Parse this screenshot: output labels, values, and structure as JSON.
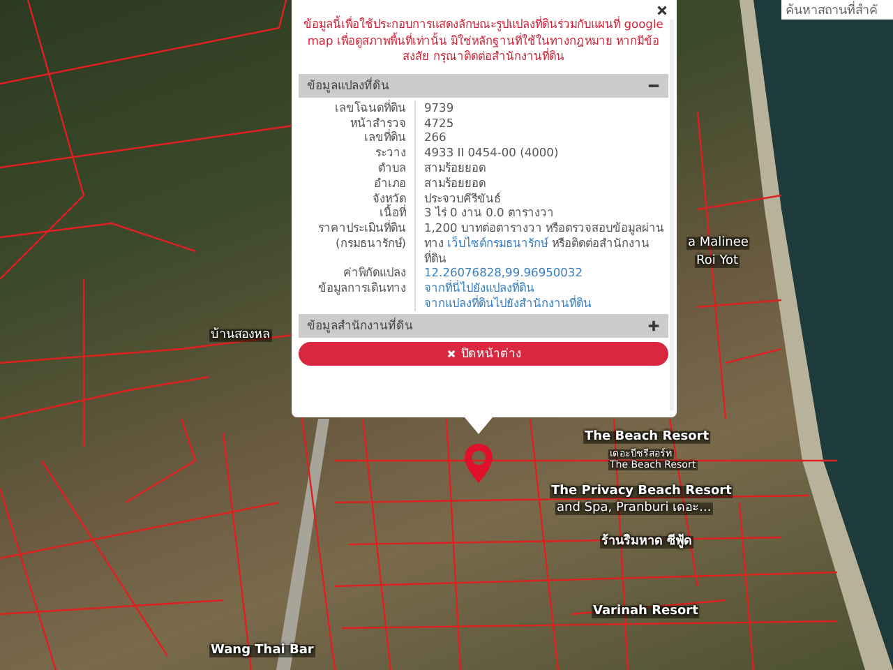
{
  "search": {
    "placeholder": "ค้นหาสถานที่สำคั"
  },
  "map_labels": [
    {
      "text": "a Malinee",
      "kind": "place"
    },
    {
      "text": "Roi Yot",
      "kind": "place"
    },
    {
      "text": "บ้านสองหล",
      "kind": "place"
    },
    {
      "text": "The Beach Resort",
      "kind": "hotel"
    },
    {
      "text": "เดอะบีชรีสอร์ท",
      "kind": "small"
    },
    {
      "text": "The Beach Resort",
      "kind": "small"
    },
    {
      "text": "The Privacy Beach Resort",
      "kind": "hotel"
    },
    {
      "text": "and Spa, Pranburi เดอะ...",
      "kind": "place"
    },
    {
      "text": "ร้านริมหาด ซีฟู้ด",
      "kind": "food"
    },
    {
      "text": "Varinah Resort",
      "kind": "hotel"
    },
    {
      "text": "Wang Thai Bar",
      "kind": "food"
    }
  ],
  "popup": {
    "notice": "ข้อมูลนี้เพื่อใช้ประกอบการแสดงลักษณะรูปแปลงที่ดินร่วมกับแผนที่ google map เพื่อดูสภาพพื้นที่เท่านั้น มิใช่หลักฐานที่ใช้ในทางกฎหมาย หากมีข้อสงสัย กรุณาติดต่อสำนักงานที่ดิน",
    "sections": [
      {
        "title": "ข้อมูลแปลงที่ดิน",
        "expanded": true,
        "rows": [
          {
            "label": "เลขโฉนดที่ดิน",
            "values": [
              [
                {
                  "kind": "text",
                  "text": "9739"
                }
              ]
            ]
          },
          {
            "label": "หน้าสำรวจ",
            "values": [
              [
                {
                  "kind": "text",
                  "text": "4725"
                }
              ]
            ]
          },
          {
            "label": "เลขที่ดิน",
            "values": [
              [
                {
                  "kind": "text",
                  "text": "266"
                }
              ]
            ]
          },
          {
            "label": "ระวาง",
            "values": [
              [
                {
                  "kind": "text",
                  "text": "4933 II 0454-00 (4000)"
                }
              ]
            ]
          },
          {
            "label": "ตำบล",
            "values": [
              [
                {
                  "kind": "text",
                  "text": "สามร้อยยอด"
                }
              ]
            ]
          },
          {
            "label": "อำเภอ",
            "values": [
              [
                {
                  "kind": "text",
                  "text": "สามร้อยยอด"
                }
              ]
            ]
          },
          {
            "label": "จังหวัด",
            "values": [
              [
                {
                  "kind": "text",
                  "text": "ประจวบคีรีขันธ์"
                }
              ]
            ]
          },
          {
            "label": "เนื้อที่",
            "values": [
              [
                {
                  "kind": "text",
                  "text": "3 ไร่ 0 งาน 0.0 ตารางวา"
                }
              ]
            ]
          },
          {
            "label": "ราคาประเมินที่ดิน (กรมธนารักษ์)",
            "values": [
              [
                {
                  "kind": "text",
                  "text": "1,200 บาทต่อตารางวา หรือตรวจสอบข้อมูลผ่านทาง"
                },
                {
                  "kind": "link",
                  "text": "เว็บไซต์กรมธนารักษ์"
                },
                {
                  "kind": "text",
                  "text": "หรือติดต่อสำนักงานที่ดิน"
                }
              ]
            ]
          },
          {
            "label": "ค่าพิกัดแปลง",
            "values": [
              [
                {
                  "kind": "link",
                  "text": "12.26076828,99.96950032"
                }
              ]
            ]
          },
          {
            "label": "ข้อมูลการเดินทาง",
            "values": [
              [
                {
                  "kind": "link",
                  "text": "จากที่นี่ไปยังแปลงที่ดิน"
                }
              ],
              [
                {
                  "kind": "link",
                  "text": "จากแปลงที่ดินไปยังสำนักงานที่ดิน"
                }
              ]
            ]
          }
        ]
      },
      {
        "title": "ข้อมูลสำนักงานที่ดิน",
        "expanded": false
      }
    ],
    "close_button": "ปิดหน้าต่าง"
  }
}
